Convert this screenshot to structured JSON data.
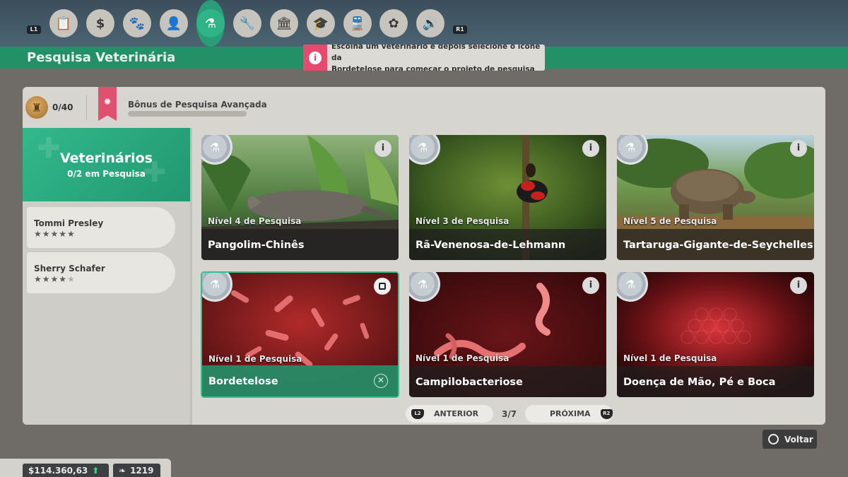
{
  "nav": {
    "left_shoulder": "L1",
    "right_shoulder": "R1",
    "tabs": [
      {
        "icon": "clipboard-icon",
        "glyph": "📋"
      },
      {
        "icon": "money-bag-icon",
        "glyph": "$"
      },
      {
        "icon": "paw-icon",
        "glyph": "🐾"
      },
      {
        "icon": "keeper-icon",
        "glyph": "👤"
      },
      {
        "icon": "flask-paw-icon",
        "glyph": "⚗"
      },
      {
        "icon": "wrench-icon",
        "glyph": "🔧"
      },
      {
        "icon": "building-icon",
        "glyph": "🏛"
      },
      {
        "icon": "graduation-cap-icon",
        "glyph": "🎓"
      },
      {
        "icon": "train-icon",
        "glyph": "🚆"
      },
      {
        "icon": "flower-icon",
        "glyph": "✿"
      },
      {
        "icon": "speaker-icon",
        "glyph": "🔊"
      }
    ]
  },
  "header": {
    "title": "Pesquisa Veterinária",
    "tooltip_line1": "Escolha um veterinário e depois selecione o ícone da",
    "tooltip_line2": "Bordetelose para começar o projeto de pesquisa"
  },
  "bonus": {
    "count": "0/40",
    "label": "Bônus de Pesquisa Avançada",
    "progress": 0
  },
  "vets": {
    "title": "Veterinários",
    "subtitle": "0/2 em Pesquisa",
    "items": [
      {
        "name": "Tommi Presley",
        "stars": 5
      },
      {
        "name": "Sherry Schafer",
        "stars": 4
      }
    ]
  },
  "cards": [
    {
      "level": "Nível 4 de Pesquisa",
      "name": "Pangolim-Chinês"
    },
    {
      "level": "Nível 3 de Pesquisa",
      "name": "Rã-Venenosa-de-Lehmann"
    },
    {
      "level": "Nível 5 de Pesquisa",
      "name": "Tartaruga-Gigante-de-Seychelles"
    },
    {
      "level": "Nível 1 de Pesquisa",
      "name": "Bordetelose"
    },
    {
      "level": "Nível 1 de Pesquisa",
      "name": "Campilobacteriose"
    },
    {
      "level": "Nível 1 de Pesquisa",
      "name": "Doença de Mão, Pé e Boca"
    }
  ],
  "pager": {
    "prev_trigger": "L2",
    "prev_label": "ANTERIOR",
    "page": "3/7",
    "next_label": "PRÓXIMA",
    "next_trigger": "R2"
  },
  "back_label": "Voltar",
  "footer": {
    "money": "$114.360,63",
    "conservation": "1219"
  },
  "colors": {
    "accent_green": "#2a9c77",
    "info_pink": "#e64a6e",
    "panel": "#d7d5d0"
  }
}
